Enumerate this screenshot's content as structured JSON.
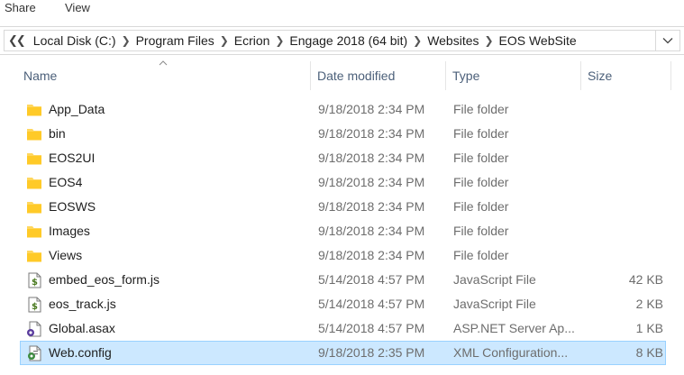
{
  "ribbon": {
    "tabs": [
      "Share",
      "View"
    ]
  },
  "address_bar": {
    "overflow_icon": "double-chevron-left",
    "breadcrumbs": [
      "Local Disk (C:)",
      "Program Files",
      "Ecrion",
      "Engage 2018 (64 bit)",
      "Websites",
      "EOS WebSite"
    ],
    "dropdown_icon": "chevron-down"
  },
  "columns": {
    "name": "Name",
    "date": "Date modified",
    "type": "Type",
    "size": "Size",
    "sort_icon": "chevron-up"
  },
  "files": [
    {
      "name": "App_Data",
      "date": "9/18/2018 2:34 PM",
      "type": "File folder",
      "size": "",
      "icon": "folder-icon",
      "selected": false
    },
    {
      "name": "bin",
      "date": "9/18/2018 2:34 PM",
      "type": "File folder",
      "size": "",
      "icon": "folder-icon",
      "selected": false
    },
    {
      "name": "EOS2UI",
      "date": "9/18/2018 2:34 PM",
      "type": "File folder",
      "size": "",
      "icon": "folder-icon",
      "selected": false
    },
    {
      "name": "EOS4",
      "date": "9/18/2018 2:34 PM",
      "type": "File folder",
      "size": "",
      "icon": "folder-icon",
      "selected": false
    },
    {
      "name": "EOSWS",
      "date": "9/18/2018 2:34 PM",
      "type": "File folder",
      "size": "",
      "icon": "folder-icon",
      "selected": false
    },
    {
      "name": "Images",
      "date": "9/18/2018 2:34 PM",
      "type": "File folder",
      "size": "",
      "icon": "folder-icon",
      "selected": false
    },
    {
      "name": "Views",
      "date": "9/18/2018 2:34 PM",
      "type": "File folder",
      "size": "",
      "icon": "folder-icon",
      "selected": false
    },
    {
      "name": "embed_eos_form.js",
      "date": "5/14/2018 4:57 PM",
      "type": "JavaScript File",
      "size": "42 KB",
      "icon": "script-file-icon",
      "selected": false
    },
    {
      "name": "eos_track.js",
      "date": "5/14/2018 4:57 PM",
      "type": "JavaScript File",
      "size": "2 KB",
      "icon": "script-file-icon",
      "selected": false
    },
    {
      "name": "Global.asax",
      "date": "5/14/2018 4:57 PM",
      "type": "ASP.NET Server Ap...",
      "size": "1 KB",
      "icon": "aspnet-file-icon",
      "selected": false
    },
    {
      "name": "Web.config",
      "date": "9/18/2018 2:35 PM",
      "type": "XML Configuration...",
      "size": "8 KB",
      "icon": "config-file-icon",
      "selected": true
    }
  ],
  "colors": {
    "selection_bg": "#cce8ff",
    "selection_border": "#99d1ff",
    "header_text": "#4c607a",
    "folder_yellow": "#ffd75e"
  }
}
